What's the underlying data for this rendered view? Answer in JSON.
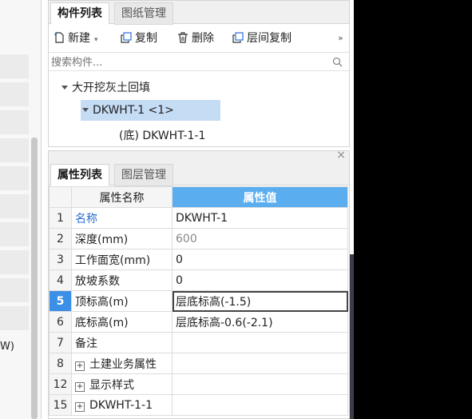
{
  "left_panel": {
    "partial_text": "W)"
  },
  "component_panel": {
    "tabs": [
      {
        "label": "构件列表"
      },
      {
        "label": "图纸管理"
      }
    ],
    "toolbar": {
      "new_label": "新建",
      "copy_label": "复制",
      "delete_label": "删除",
      "floor_copy_label": "层间复制",
      "more_label": "»"
    },
    "search": {
      "placeholder": "搜索构件..."
    },
    "tree": {
      "root": "大开挖灰土回填",
      "child": "DKWHT-1 <1>",
      "grandchild": "(底) DKWHT-1-1"
    }
  },
  "property_panel": {
    "close_label": "×",
    "tabs": [
      {
        "label": "属性列表"
      },
      {
        "label": "图层管理"
      }
    ],
    "header": {
      "name": "属性名称",
      "value": "属性值"
    },
    "rows": [
      {
        "num": "1",
        "name": "名称",
        "value": "DKWHT-1"
      },
      {
        "num": "2",
        "name": "深度(mm)",
        "value": "600"
      },
      {
        "num": "3",
        "name": "工作面宽(mm)",
        "value": "0"
      },
      {
        "num": "4",
        "name": "放坡系数",
        "value": "0"
      },
      {
        "num": "5",
        "name": "顶标高(m)",
        "value": "层底标高(-1.5)"
      },
      {
        "num": "6",
        "name": "底标高(m)",
        "value": "层底标高-0.6(-2.1)"
      },
      {
        "num": "7",
        "name": "备注",
        "value": ""
      },
      {
        "num": "8",
        "name": "土建业务属性",
        "value": ""
      },
      {
        "num": "12",
        "name": "显示样式",
        "value": ""
      },
      {
        "num": "15",
        "name": "DKWHT-1-1",
        "value": ""
      }
    ]
  },
  "colors": {
    "accent": "#5aaef0",
    "selected_row": "#3b8fe6",
    "tree_highlight": "#c5dcf5",
    "link_blue": "#2b6fd6"
  }
}
